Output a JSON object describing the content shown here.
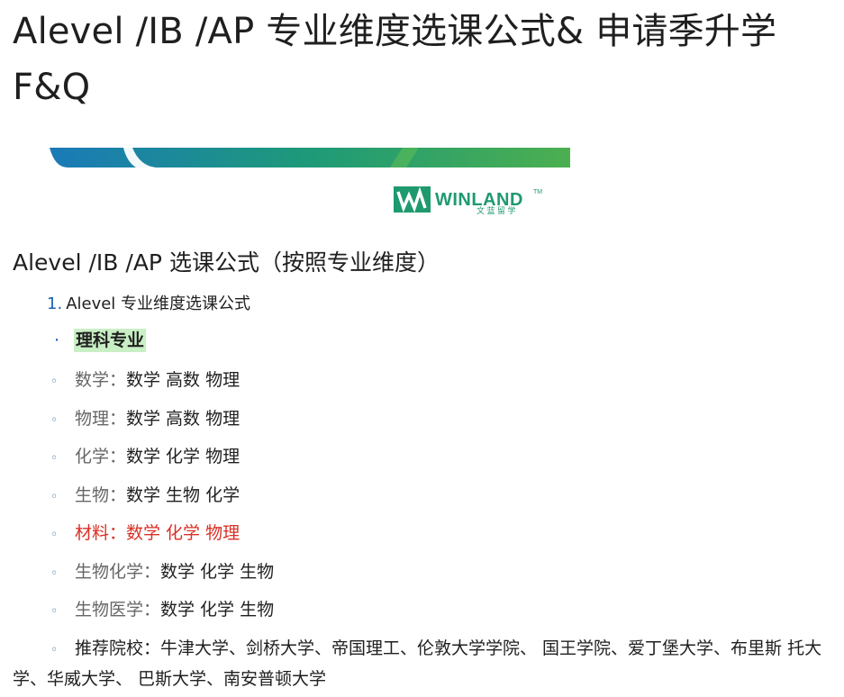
{
  "title": "Alevel /IB /AP 专业维度选课公式& 申请季升学 F&Q",
  "logo": {
    "brand": "WINLAND",
    "tm": "TM",
    "subtitle": "文 蓝 留 学"
  },
  "section_heading": "Alevel /IB /AP 选课公式（按照专业维度）",
  "ordered_item": {
    "number": "1.",
    "text": "Alevel 专业维度选课公式"
  },
  "bullet_item": {
    "dot": "·",
    "text": "理科专业"
  },
  "subjects": [
    {
      "label": "数学：",
      "value": "数学 高数 物理",
      "highlight": false
    },
    {
      "label": "物理：",
      "value": "数学 高数 物理",
      "highlight": false
    },
    {
      "label": "化学：",
      "value": "数学 化学 物理",
      "highlight": false
    },
    {
      "label": "生物：",
      "value": "数学 生物 化学",
      "highlight": false
    },
    {
      "label": "材料：",
      "value": "数学 化学 物理",
      "highlight": true
    },
    {
      "label": "生物化学：",
      "value": "数学 化学 生物",
      "highlight": false
    },
    {
      "label": "生物医学：",
      "value": "数学 化学 生物",
      "highlight": false
    }
  ],
  "recommended": {
    "label": "推荐院校：",
    "value": "牛津大学、剑桥大学、帝国理工、伦敦大学学院、 国王学院、爱丁堡大学、布里斯 托大学、华威大学、 巴斯大学、南安普顿大学"
  },
  "colors": {
    "banner_blue": "#1a7ab8",
    "banner_teal": "#1e9a78",
    "banner_green": "#4caf50",
    "logo_green": "#1f9a6e",
    "highlight_bg": "#c9efc4",
    "highlight_red": "#d93025",
    "list_marker_blue": "#1a5fb4"
  },
  "icons": {
    "sub_bullet": "hollow-circle",
    "bullet": "dot"
  }
}
